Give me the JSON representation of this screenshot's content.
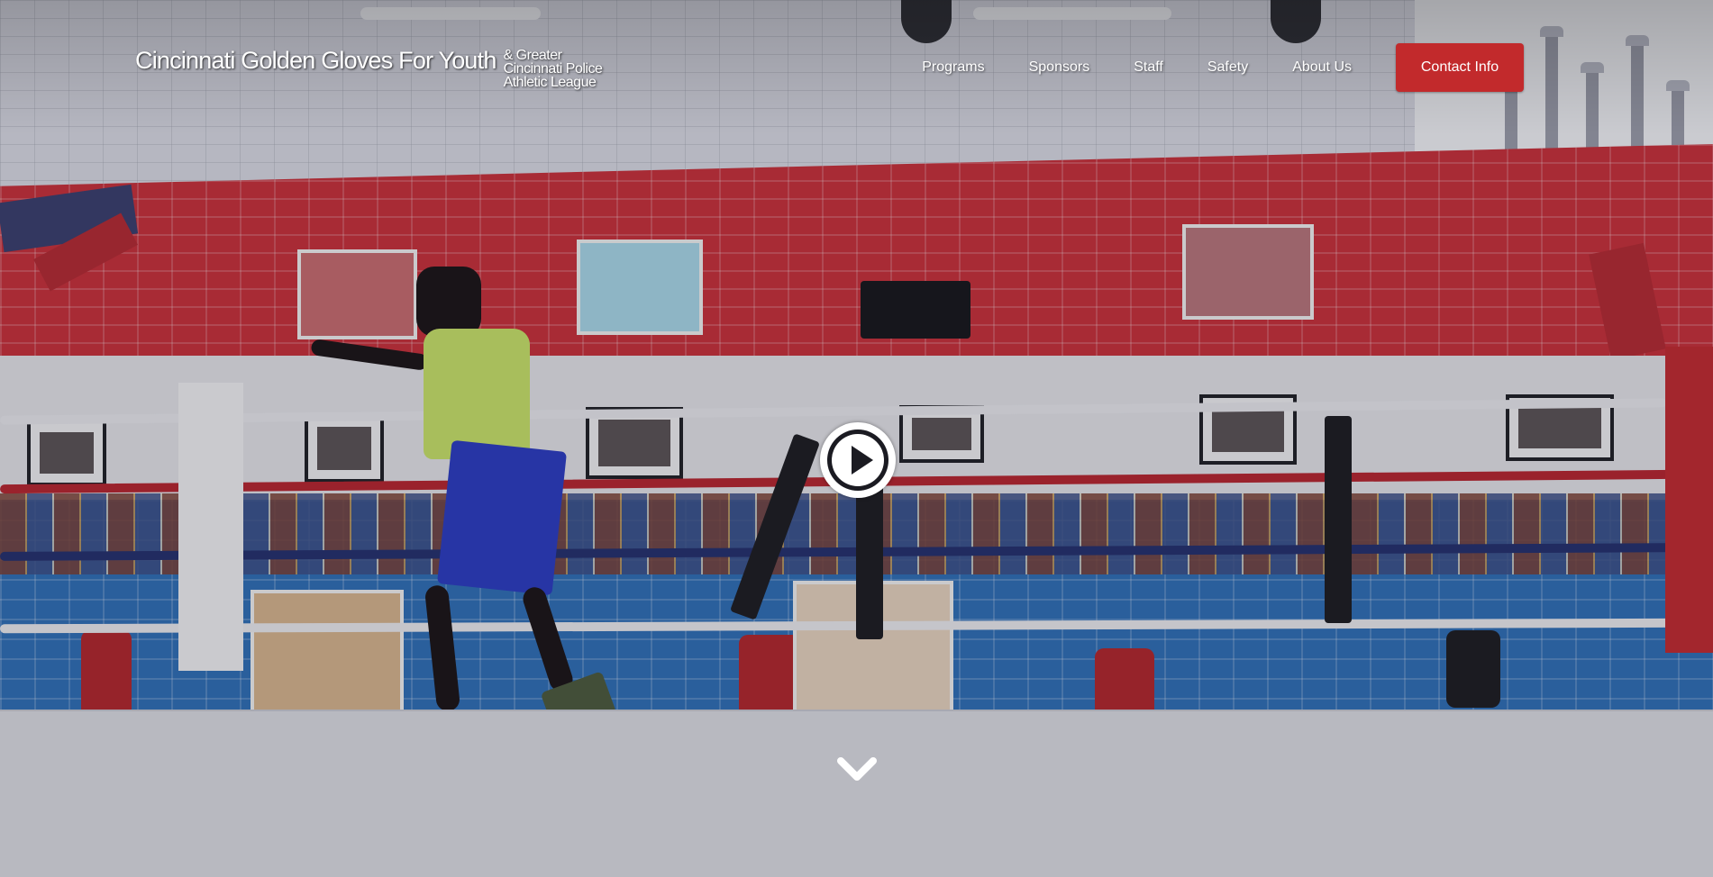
{
  "brand": {
    "main": "Cincinnati Golden Gloves For Youth",
    "sub": "& Greater Cincinnati Police Athletic League"
  },
  "nav": {
    "items": [
      {
        "label": "Programs"
      },
      {
        "label": "Sponsors"
      },
      {
        "label": "Staff"
      },
      {
        "label": "Safety"
      },
      {
        "label": "About Us"
      }
    ],
    "cta_label": "Contact Info"
  },
  "hero": {
    "play_icon": "play-circle-icon",
    "scroll_icon": "chevron-down-icon"
  },
  "colors": {
    "accent": "#c22a2c",
    "text": "#ffffff"
  }
}
